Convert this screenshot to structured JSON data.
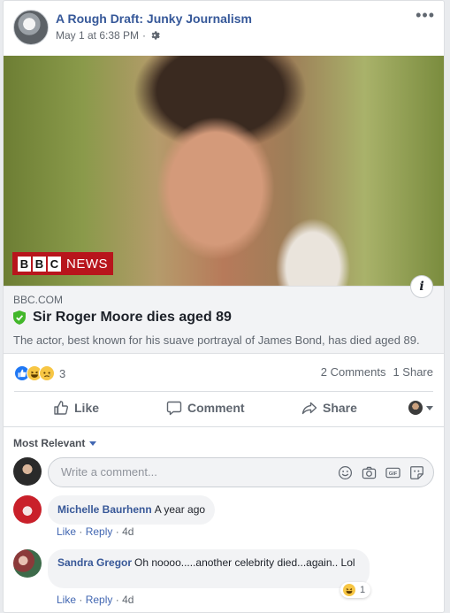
{
  "post": {
    "page_name": "A Rough Draft: Junky Journalism",
    "timestamp": "May 1 at 6:38 PM",
    "separator": "·",
    "privacy_icon": "gear-icon",
    "more_label": "•••"
  },
  "link": {
    "logo_letters": [
      "B",
      "B",
      "C"
    ],
    "logo_word": "NEWS",
    "info_label": "i",
    "domain": "BBC.COM",
    "verified_icon": "shield-check-icon",
    "title": "Sir Roger Moore dies aged 89",
    "description": "The actor, best known for his suave portrayal of James Bond, has died aged 89."
  },
  "stats": {
    "reaction_icons": [
      "like-icon",
      "haha-icon",
      "sad-icon"
    ],
    "reaction_count": "3",
    "comments": "2 Comments",
    "shares": "1 Share"
  },
  "actions": {
    "like": "Like",
    "comment": "Comment",
    "share": "Share"
  },
  "comments_section": {
    "sort_label": "Most Relevant",
    "placeholder": "Write a comment...",
    "input_icons": [
      "emoji-icon",
      "camera-icon",
      "gif-icon",
      "sticker-icon"
    ],
    "items": [
      {
        "author": "Michelle Baurhenn",
        "text": "A year ago",
        "like": "Like",
        "dot": "·",
        "reply": "Reply",
        "time": "4d"
      },
      {
        "author": "Sandra Gregor",
        "text": "Oh noooo.....another celebrity died...again.. Lol",
        "like": "Like",
        "dot": "·",
        "reply": "Reply",
        "time": "4d",
        "reaction_icon": "haha-icon",
        "reaction_count": "1"
      }
    ]
  },
  "colors": {
    "link_blue": "#385898",
    "action_blue": "#4267b2",
    "bbc_red": "#b8151c",
    "verified_green": "#42b72a"
  }
}
